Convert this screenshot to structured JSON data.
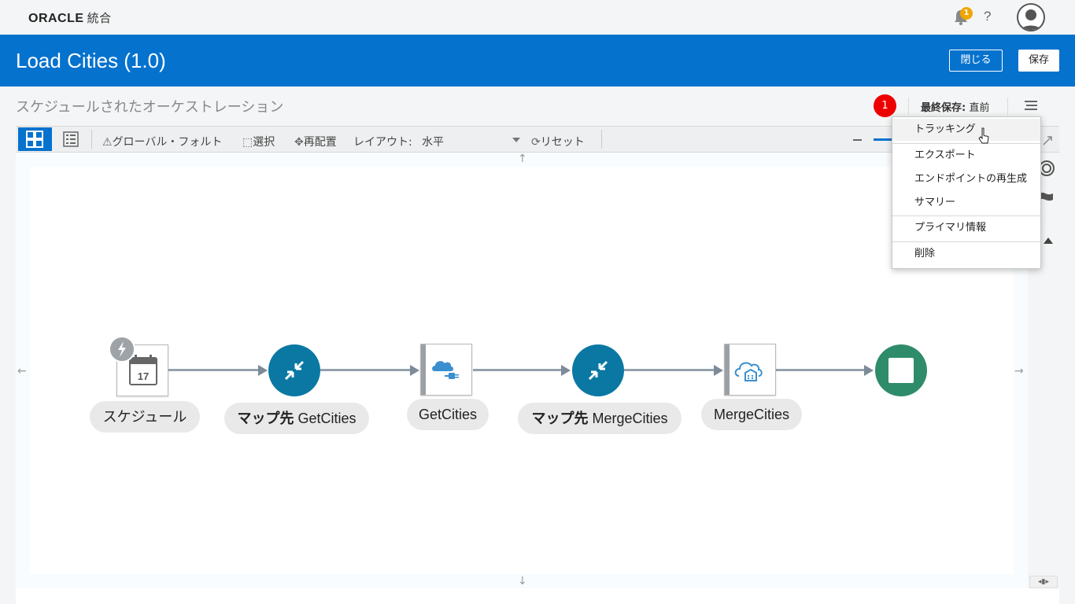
{
  "header": {
    "logo_brand": "ORACLE",
    "logo_product": "統合",
    "notification_count": "1",
    "help_label": "?"
  },
  "title_band": {
    "title": "Load Cities (1.0)",
    "close_label": "閉じる",
    "save_label": "保存"
  },
  "subheader": {
    "subtitle": "スケジュールされたオーケストレーション",
    "error_count": "1",
    "last_saved_label": "最終保存:",
    "last_saved_value": "直前"
  },
  "toolbar": {
    "global_fault": "グローバル・フォルト",
    "select": "選択",
    "rearrange": "再配置",
    "layout_label": "レイアウト:",
    "layout_value": "水平",
    "reset": "リセット"
  },
  "flow": {
    "nodes": [
      {
        "label": "スケジュール",
        "bold_prefix": "",
        "icon": "calendar-icon",
        "calendar_day": "17"
      },
      {
        "label": "GetCities",
        "bold_prefix": "マップ先",
        "icon": "map-icon"
      },
      {
        "label": "GetCities",
        "bold_prefix": "",
        "icon": "cloud-plug-icon"
      },
      {
        "label": "MergeCities",
        "bold_prefix": "マップ先",
        "icon": "map-icon"
      },
      {
        "label": "MergeCities",
        "bold_prefix": "",
        "icon": "cloud-building-icon"
      },
      {
        "label": "",
        "bold_prefix": "",
        "icon": "stop-icon"
      }
    ]
  },
  "menu": {
    "items": [
      {
        "label": "トラッキング",
        "hover": true
      },
      {
        "label": "エクスポート"
      },
      {
        "label": "エンドポイントの再生成"
      },
      {
        "label": "サマリー"
      },
      {
        "label": "プライマリ情報"
      },
      {
        "label": "削除"
      }
    ]
  },
  "colors": {
    "brand_blue": "#0572ce",
    "map_teal": "#0a78a3",
    "end_green": "#2f8c6a",
    "error_red": "#ee0000",
    "badge_orange": "#f0a500"
  }
}
